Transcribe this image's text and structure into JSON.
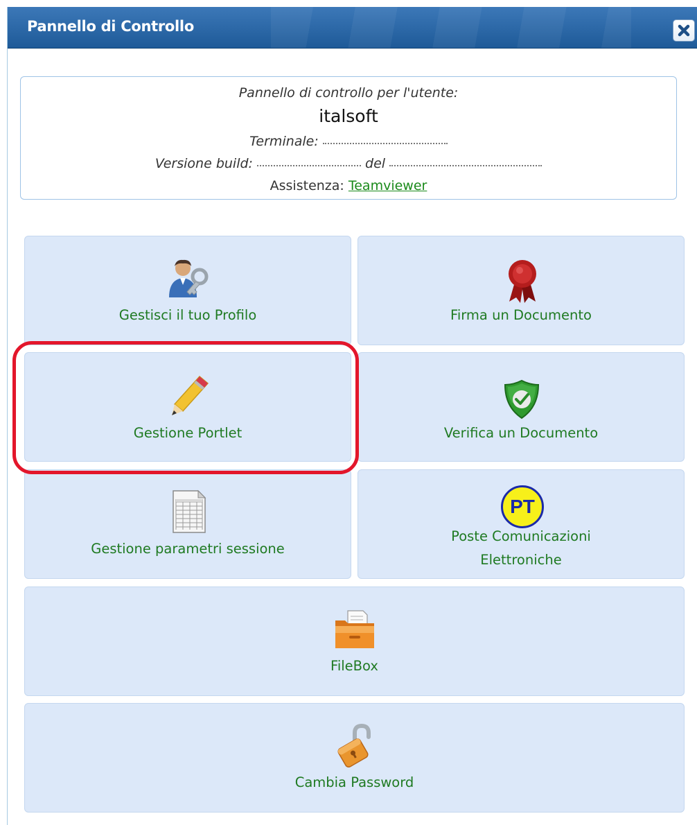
{
  "dialog": {
    "title": "Pannello di Controllo",
    "close_label": "×"
  },
  "info": {
    "header": "Pannello di controllo per l'utente:",
    "username": "italsoft",
    "terminal_label": "Terminale:",
    "build_label": "Versione build:",
    "build_date_label": "del",
    "support_label": "Assistenza:",
    "support_link": "Teamviewer"
  },
  "tiles": {
    "profile": {
      "label": "Gestisci il tuo Profilo",
      "icon": "user-key-icon"
    },
    "sign": {
      "label": "Firma un Documento",
      "icon": "ribbon-seal-icon"
    },
    "portlet": {
      "label": "Gestione Portlet",
      "icon": "pencil-icon"
    },
    "verify": {
      "label": "Verifica un Documento",
      "icon": "shield-check-icon"
    },
    "session": {
      "label": "Gestione parametri sessione",
      "icon": "spreadsheet-icon"
    },
    "poste": {
      "label_line1": "Poste Comunicazioni",
      "label_line2": "Elettroniche",
      "icon_text": "PT",
      "icon": "pt-logo-icon"
    },
    "filebox": {
      "label": "FileBox",
      "icon": "filebox-icon"
    },
    "password": {
      "label": "Cambia Password",
      "icon": "padlock-open-icon"
    }
  },
  "colors": {
    "titlebar": "#2a66a6",
    "tile_bg": "#dce8f9",
    "tile_text": "#1f7a22",
    "highlight": "#e3162b"
  }
}
